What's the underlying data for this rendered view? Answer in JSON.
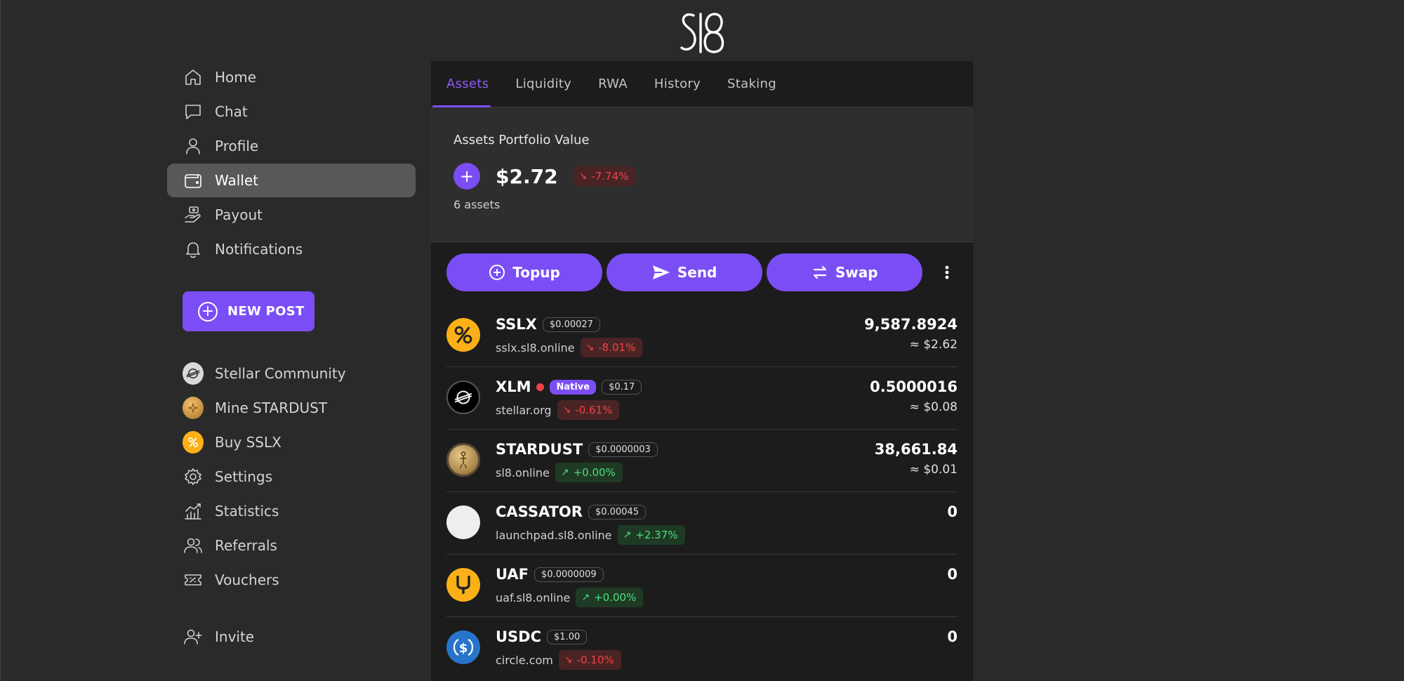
{
  "colors": {
    "accent": "#7b4ef5",
    "negative": "#ef4444",
    "positive": "#4ade80"
  },
  "logo": {
    "text": "Sl8"
  },
  "sidebar": {
    "items": [
      {
        "label": "Home",
        "icon": "home-icon"
      },
      {
        "label": "Chat",
        "icon": "chat-icon"
      },
      {
        "label": "Profile",
        "icon": "profile-icon"
      },
      {
        "label": "Wallet",
        "icon": "wallet-icon",
        "active": true
      },
      {
        "label": "Payout",
        "icon": "payout-icon"
      },
      {
        "label": "Notifications",
        "icon": "bell-icon"
      }
    ],
    "new_post_label": "NEW POST",
    "links": [
      {
        "label": "Stellar Community",
        "icon": "stellar-icon"
      },
      {
        "label": "Mine STARDUST",
        "icon": "stardust-coin-icon"
      },
      {
        "label": "Buy SSLX",
        "icon": "sslx-coin-icon"
      },
      {
        "label": "Settings",
        "icon": "gear-icon"
      },
      {
        "label": "Statistics",
        "icon": "chart-icon"
      },
      {
        "label": "Referrals",
        "icon": "users-icon"
      },
      {
        "label": "Vouchers",
        "icon": "ticket-icon"
      }
    ],
    "invite_label": "Invite"
  },
  "tabs": [
    "Assets",
    "Liquidity",
    "RWA",
    "History",
    "Staking"
  ],
  "portfolio": {
    "title": "Assets Portfolio Value",
    "value": "$2.72",
    "change": "-7.74%",
    "count": "6 assets"
  },
  "actions": {
    "topup": "Topup",
    "send": "Send",
    "swap": "Swap"
  },
  "assets": [
    {
      "symbol": "SSLX",
      "price": "$0.00027",
      "domain": "sslx.sl8.online",
      "change": "-8.01%",
      "amount": "9,587.8924",
      "usd": "≈ $2.62"
    },
    {
      "symbol": "XLM",
      "native": "Native",
      "price": "$0.17",
      "domain": "stellar.org",
      "change": "-0.61%",
      "amount": "0.5000016",
      "usd": "≈ $0.08"
    },
    {
      "symbol": "STARDUST",
      "price": "$0.0000003",
      "domain": "sl8.online",
      "change": "+0.00%",
      "amount": "38,661.84",
      "usd": "≈ $0.01"
    },
    {
      "symbol": "CASSATOR",
      "price": "$0.00045",
      "domain": "launchpad.sl8.online",
      "change": "+2.37%",
      "amount": "0",
      "usd": ""
    },
    {
      "symbol": "UAF",
      "price": "$0.0000009",
      "domain": "uaf.sl8.online",
      "change": "+0.00%",
      "amount": "0",
      "usd": ""
    },
    {
      "symbol": "USDC",
      "price": "$1.00",
      "domain": "circle.com",
      "change": "-0.10%",
      "amount": "0",
      "usd": ""
    }
  ]
}
